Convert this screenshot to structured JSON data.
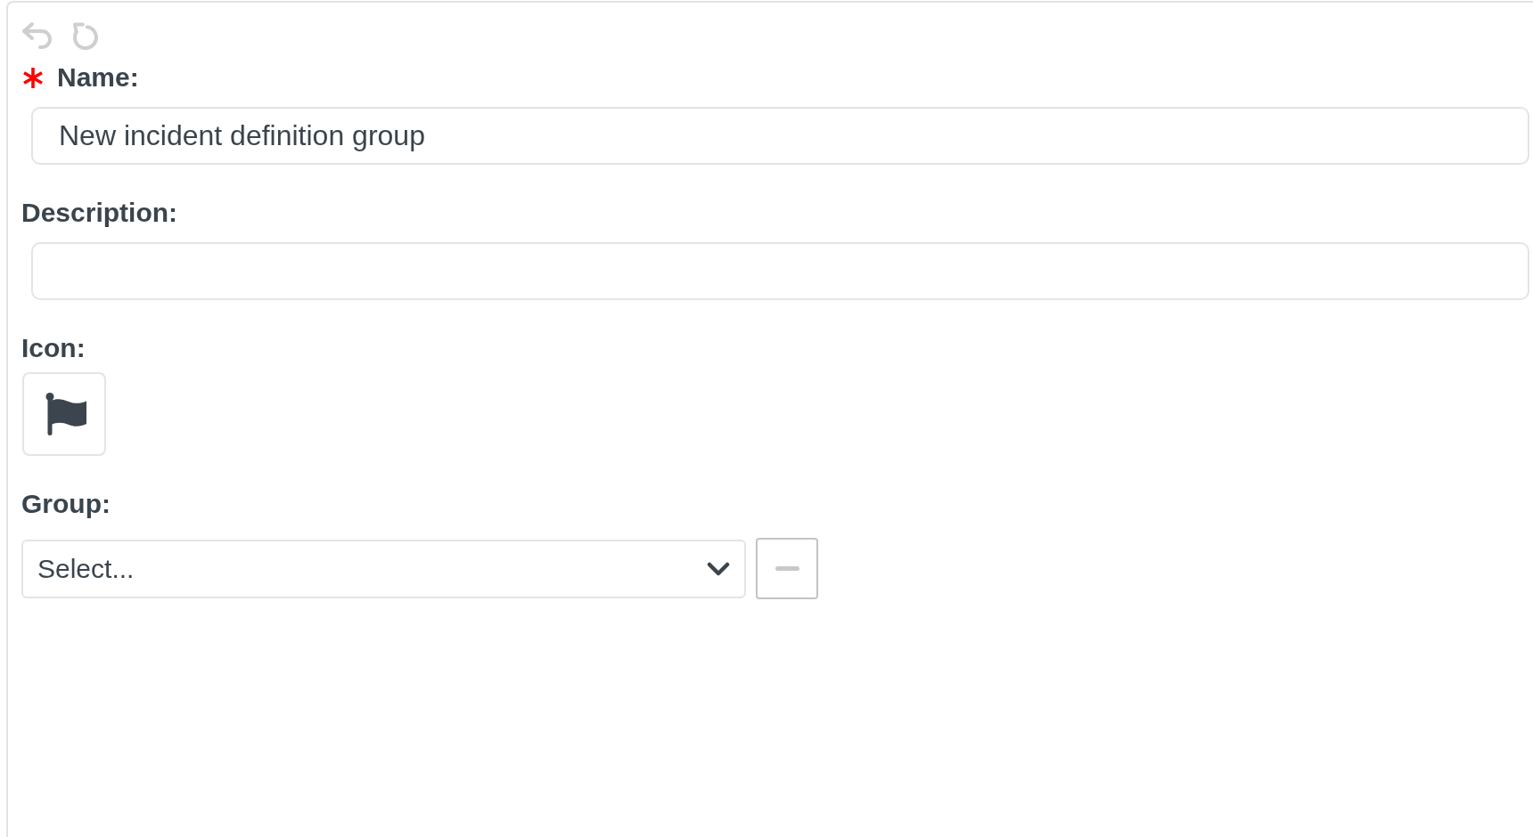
{
  "toolbar": [
    {
      "kind": "undo",
      "disabled": true
    },
    {
      "kind": "redo",
      "disabled": true
    }
  ],
  "fields": [
    {
      "kind": "text",
      "label": "Name:",
      "required": true,
      "value": "New incident definition group"
    },
    {
      "kind": "text",
      "label": "Description:",
      "required": false
    },
    {
      "kind": "icon",
      "label": "Icon:",
      "required": false
    },
    {
      "kind": "select",
      "label": "Group:",
      "required": false,
      "placeholder": "Select..."
    }
  ]
}
